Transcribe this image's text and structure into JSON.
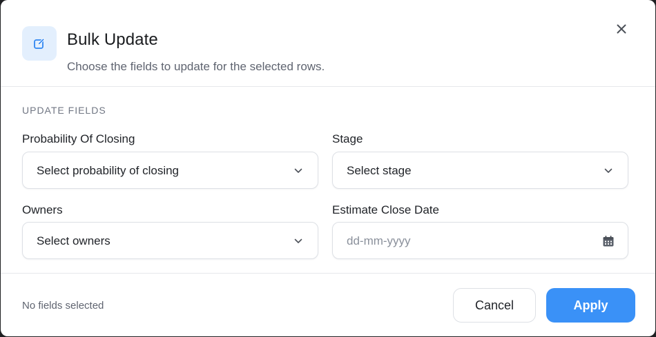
{
  "dialog": {
    "title": "Bulk Update",
    "subtitle": "Choose the fields to update for the selected rows.",
    "header_icon": "edit-pencil-icon",
    "close_icon": "close-icon"
  },
  "section": {
    "label": "UPDATE FIELDS"
  },
  "fields": {
    "probability": {
      "label": "Probability Of Closing",
      "placeholder": "Select probability of closing",
      "icon": "chevron-down-icon"
    },
    "stage": {
      "label": "Stage",
      "placeholder": "Select stage",
      "icon": "chevron-down-icon"
    },
    "owners": {
      "label": "Owners",
      "placeholder": "Select owners",
      "icon": "chevron-down-icon"
    },
    "close_date": {
      "label": "Estimate Close Date",
      "placeholder": "dd-mm-yyyy",
      "icon": "calendar-icon"
    }
  },
  "footer": {
    "status": "No fields selected",
    "cancel_label": "Cancel",
    "apply_label": "Apply"
  },
  "colors": {
    "accent": "#3a91f7",
    "icon_bg": "#e3effd",
    "border": "#dde0e5"
  }
}
